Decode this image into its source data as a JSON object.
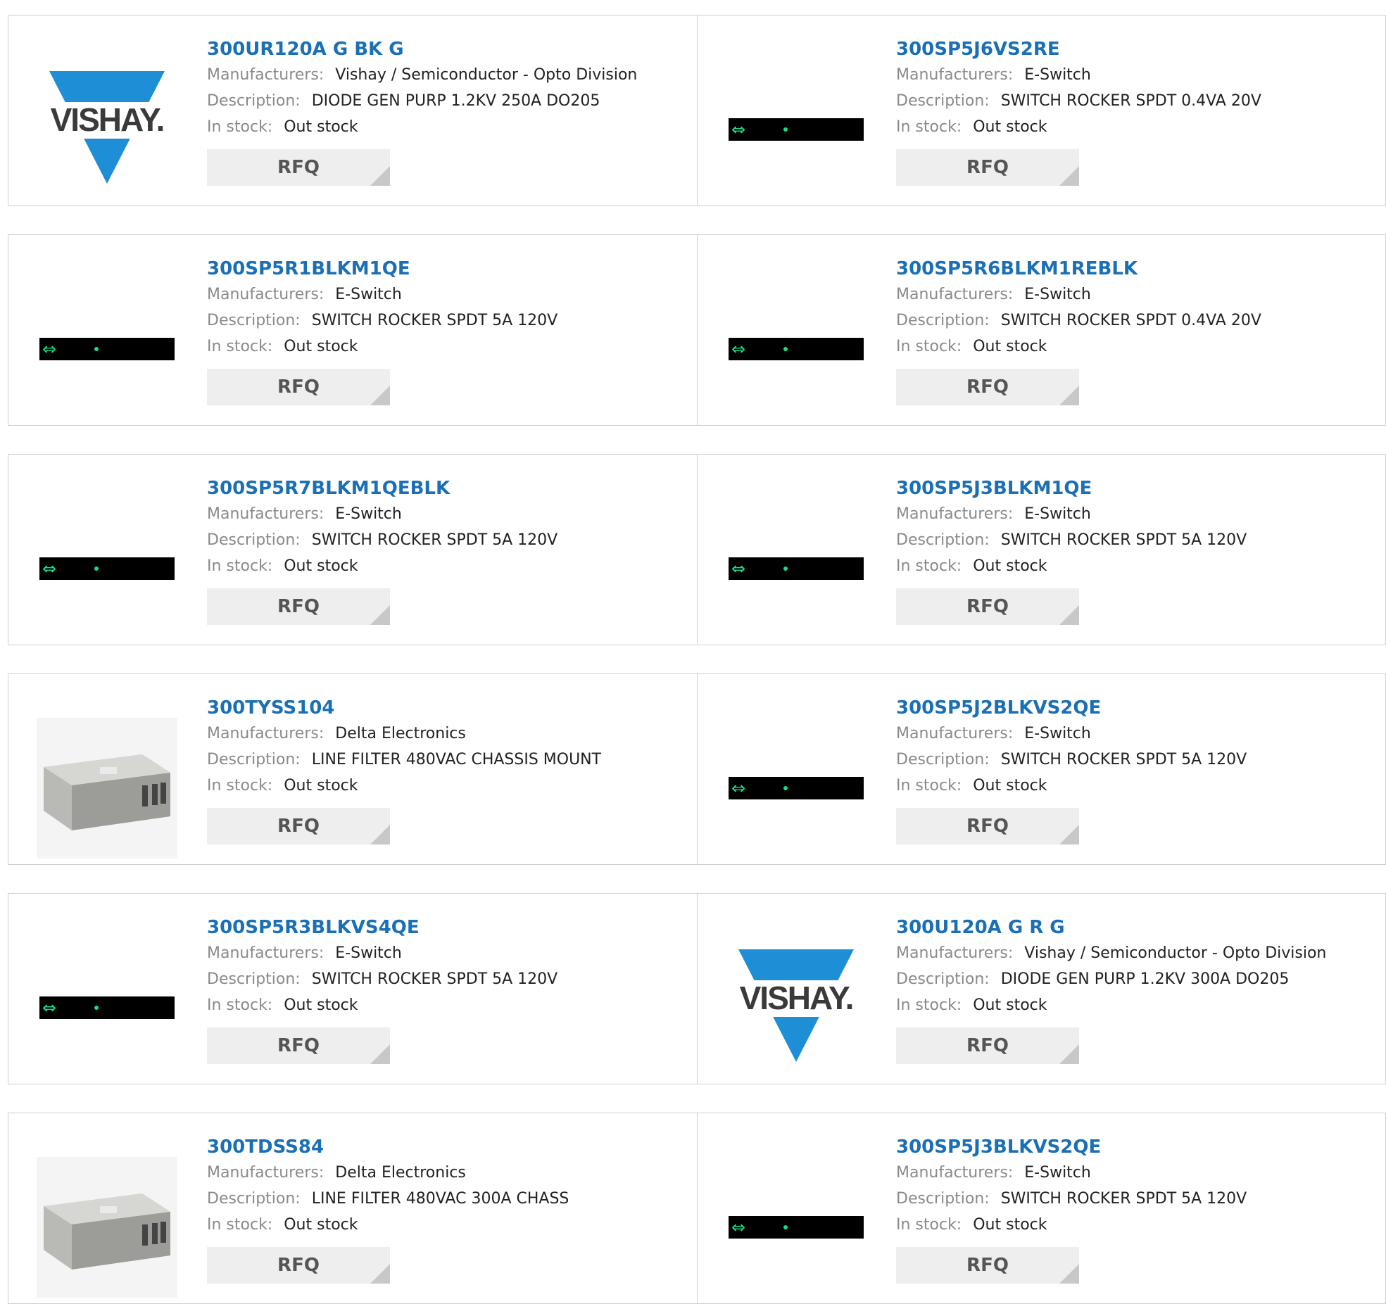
{
  "labels": {
    "manufacturers": "Manufacturers:",
    "description": "Description:",
    "in_stock": "In stock:",
    "rfq": "RFQ",
    "logo_text": "VISHAY."
  },
  "colors": {
    "part_link": "#1a6fb5",
    "label": "#8a8a8a",
    "switch_accent": "#14e08a",
    "vishay_blue": "#1e8fd6"
  },
  "products": [
    {
      "part": "300UR120A G BK G",
      "manufacturer": "Vishay / Semiconductor - Opto Division",
      "description": "DIODE GEN PURP 1.2KV 250A DO205",
      "stock": "Out stock",
      "image": "vishay-logo"
    },
    {
      "part": "300SP5J6VS2RE",
      "manufacturer": "E-Switch",
      "description": "SWITCH ROCKER SPDT 0.4VA 20V",
      "stock": "Out stock",
      "image": "switch-strip"
    },
    {
      "part": "300SP5R1BLKM1QE",
      "manufacturer": "E-Switch",
      "description": "SWITCH ROCKER SPDT 5A 120V",
      "stock": "Out stock",
      "image": "switch-strip"
    },
    {
      "part": "300SP5R6BLKM1REBLK",
      "manufacturer": "E-Switch",
      "description": "SWITCH ROCKER SPDT 0.4VA 20V",
      "stock": "Out stock",
      "image": "switch-strip"
    },
    {
      "part": "300SP5R7BLKM1QEBLK",
      "manufacturer": "E-Switch",
      "description": "SWITCH ROCKER SPDT 5A 120V",
      "stock": "Out stock",
      "image": "switch-strip"
    },
    {
      "part": "300SP5J3BLKM1QE",
      "manufacturer": "E-Switch",
      "description": "SWITCH ROCKER SPDT 5A 120V",
      "stock": "Out stock",
      "image": "switch-strip"
    },
    {
      "part": "300TYSS104",
      "manufacturer": "Delta Electronics",
      "description": "LINE FILTER 480VAC CHASSIS MOUNT",
      "stock": "Out stock",
      "image": "line-filter-photo"
    },
    {
      "part": "300SP5J2BLKVS2QE",
      "manufacturer": "E-Switch",
      "description": "SWITCH ROCKER SPDT 5A 120V",
      "stock": "Out stock",
      "image": "switch-strip"
    },
    {
      "part": "300SP5R3BLKVS4QE",
      "manufacturer": "E-Switch",
      "description": "SWITCH ROCKER SPDT 5A 120V",
      "stock": "Out stock",
      "image": "switch-strip"
    },
    {
      "part": "300U120A G R G",
      "manufacturer": "Vishay / Semiconductor - Opto Division",
      "description": "DIODE GEN PURP 1.2KV 300A DO205",
      "stock": "Out stock",
      "image": "vishay-logo"
    },
    {
      "part": "300TDSS84",
      "manufacturer": "Delta Electronics",
      "description": "LINE FILTER 480VAC 300A CHASS",
      "stock": "Out stock",
      "image": "line-filter-photo"
    },
    {
      "part": "300SP5J3BLKVS2QE",
      "manufacturer": "E-Switch",
      "description": "SWITCH ROCKER SPDT 5A 120V",
      "stock": "Out stock",
      "image": "switch-strip"
    }
  ]
}
